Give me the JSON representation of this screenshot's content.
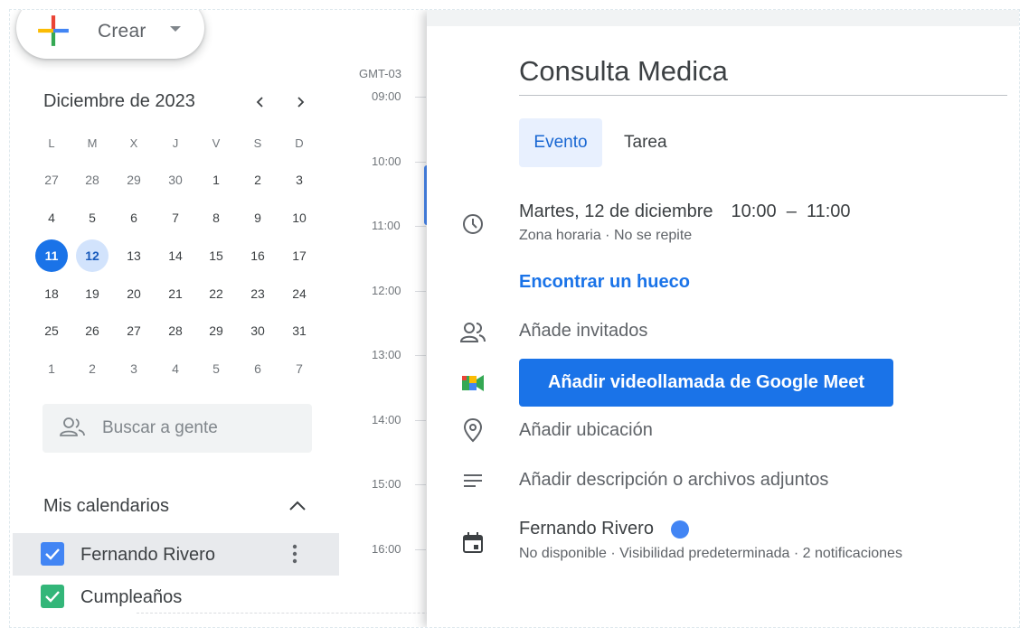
{
  "create": {
    "label": "Crear"
  },
  "mini_calendar": {
    "month_label": "Diciembre de 2023",
    "prev_icon": "chevron-left-icon",
    "next_icon": "chevron-right-icon",
    "weekdays": [
      "L",
      "M",
      "X",
      "J",
      "V",
      "S",
      "D"
    ],
    "weeks": [
      [
        "27",
        "28",
        "29",
        "30",
        "1",
        "2",
        "3"
      ],
      [
        "4",
        "5",
        "6",
        "7",
        "8",
        "9",
        "10"
      ],
      [
        "11",
        "12",
        "13",
        "14",
        "15",
        "16",
        "17"
      ],
      [
        "18",
        "19",
        "20",
        "21",
        "22",
        "23",
        "24"
      ],
      [
        "25",
        "26",
        "27",
        "28",
        "29",
        "30",
        "31"
      ],
      [
        "1",
        "2",
        "3",
        "4",
        "5",
        "6",
        "7"
      ]
    ],
    "today": "11",
    "selected": "12"
  },
  "people_search": {
    "placeholder": "Buscar a gente",
    "icon": "people-icon"
  },
  "my_calendars": {
    "title": "Mis calendarios",
    "items": [
      {
        "label": "Fernando Rivero",
        "color": "#4285f4",
        "checked": true
      },
      {
        "label": "Cumpleaños",
        "color": "#33b679",
        "checked": true
      }
    ]
  },
  "time_grid": {
    "timezone": "GMT-03",
    "hours": [
      "09:00",
      "10:00",
      "11:00",
      "12:00",
      "13:00",
      "14:00",
      "15:00",
      "16:00"
    ]
  },
  "event_editor": {
    "title": "Consulta Medica",
    "tabs": {
      "active": "Evento",
      "other": "Tarea"
    },
    "date": "Martes, 12 de diciembre",
    "time_range": "10:00  –  11:00",
    "timezone_repeat": "Zona horaria · No se repite",
    "find_slot": "Encontrar un hueco",
    "add_guests": "Añade invitados",
    "meet_button": "Añadir videollamada de Google Meet",
    "add_location": "Añadir ubicación",
    "add_description": "Añadir descripción o archivos adjuntos",
    "calendar_owner": "Fernando Rivero",
    "calendar_color": "#4285f4",
    "calendar_details": "No disponible · Visibilidad predeterminada · 2 notificaciones"
  },
  "colors": {
    "accent": "#1a73e8",
    "selected_bg": "#e8f0fe"
  }
}
